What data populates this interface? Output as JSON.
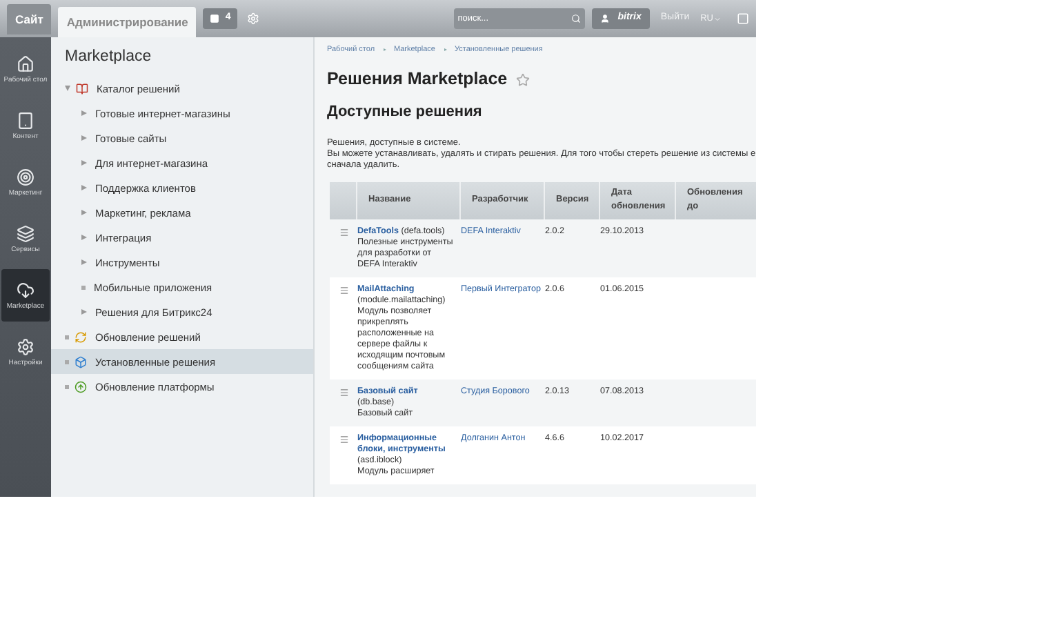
{
  "top_bar": {
    "tabs": [
      {
        "label": "Сайт",
        "selected": false
      },
      {
        "label": "Администрирование",
        "selected": true
      }
    ],
    "notifications": "4",
    "search": {
      "placeholder": "поиск..."
    },
    "user": "bitrix",
    "logout": "Выйти",
    "language": "RU"
  },
  "sidebar": {
    "items": [
      {
        "label": "Рабочий стол",
        "selected": false
      },
      {
        "label": "Контент",
        "selected": false
      },
      {
        "label": "Маркетинг",
        "selected": false
      },
      {
        "label": "Сервисы",
        "selected": false
      },
      {
        "label": "Marketplace",
        "selected": true
      },
      {
        "label": "Настройки",
        "selected": false
      }
    ]
  },
  "tree": {
    "title": "Marketplace",
    "items": [
      {
        "label": "Каталог решений",
        "kind": "folder",
        "expanded": true,
        "selected": false,
        "children": [
          {
            "label": "Готовые интернет-магазины",
            "kind": "folder",
            "expanded": false,
            "selected": false
          },
          {
            "label": "Готовые сайты",
            "kind": "folder",
            "expanded": false,
            "selected": false
          },
          {
            "label": "Для интернет-магазина",
            "kind": "folder",
            "expanded": false,
            "selected": false
          },
          {
            "label": "Поддержка клиентов",
            "kind": "folder",
            "expanded": false,
            "selected": false
          },
          {
            "label": "Маркетинг, реклама",
            "kind": "folder",
            "expanded": false,
            "selected": false
          },
          {
            "label": "Интеграция",
            "kind": "folder",
            "expanded": false,
            "selected": false
          },
          {
            "label": "Инструменты",
            "kind": "folder",
            "expanded": false,
            "selected": false
          },
          {
            "label": "Мобильные приложения",
            "kind": "leaf",
            "selected": false
          },
          {
            "label": "Решения для Битрикс24",
            "kind": "folder",
            "expanded": false,
            "selected": false
          }
        ]
      },
      {
        "label": "Обновление решений",
        "kind": "leaf",
        "selected": false
      },
      {
        "label": "Установленные решения",
        "kind": "leaf",
        "selected": true
      },
      {
        "label": "Обновление платформы",
        "kind": "leaf",
        "selected": false
      }
    ]
  },
  "breadcrumbs": [
    "Рабочий стол",
    "Marketplace",
    "Установленные решения"
  ],
  "page_title": "Решения Marketplace",
  "section_title": "Доступные решения",
  "intro": [
    "Решения, доступные в системе.",
    "Вы можете устанавливать, удалять и стирать решения. Для того чтобы стереть решение из системы е",
    "сначала удалить."
  ],
  "table": {
    "columns": [
      "Название",
      "Разработчик",
      "Версия",
      "Дата обновления",
      "Обновления до"
    ],
    "rows": [
      {
        "name": "DefaTools",
        "code": "(defa.tools)",
        "description": "Полезные инструменты для разработки от DEFA Interaktiv",
        "developer": "DEFA Interaktiv",
        "version": "2.0.2",
        "date": "29.10.2013"
      },
      {
        "name": "MailAttaching",
        "code": "(module.mailattaching)",
        "description": "Модуль позволяет прикреплять расположенные на сервере файлы к исходящим почтовым сообщениям сайта",
        "developer": "Первый Интегратор",
        "version": "2.0.6",
        "date": "01.06.2015"
      },
      {
        "name": "Базовый сайт",
        "code": "(db.base)",
        "description": "Базовый сайт",
        "developer": "Студия Борового",
        "version": "2.0.13",
        "date": "07.08.2013"
      },
      {
        "name": "Информационные блоки, инструменты",
        "code": "(asd.iblock)",
        "description": "Модуль расширяет",
        "developer": "Долганин Антон",
        "version": "4.6.6",
        "date": "10.02.2017"
      }
    ]
  }
}
